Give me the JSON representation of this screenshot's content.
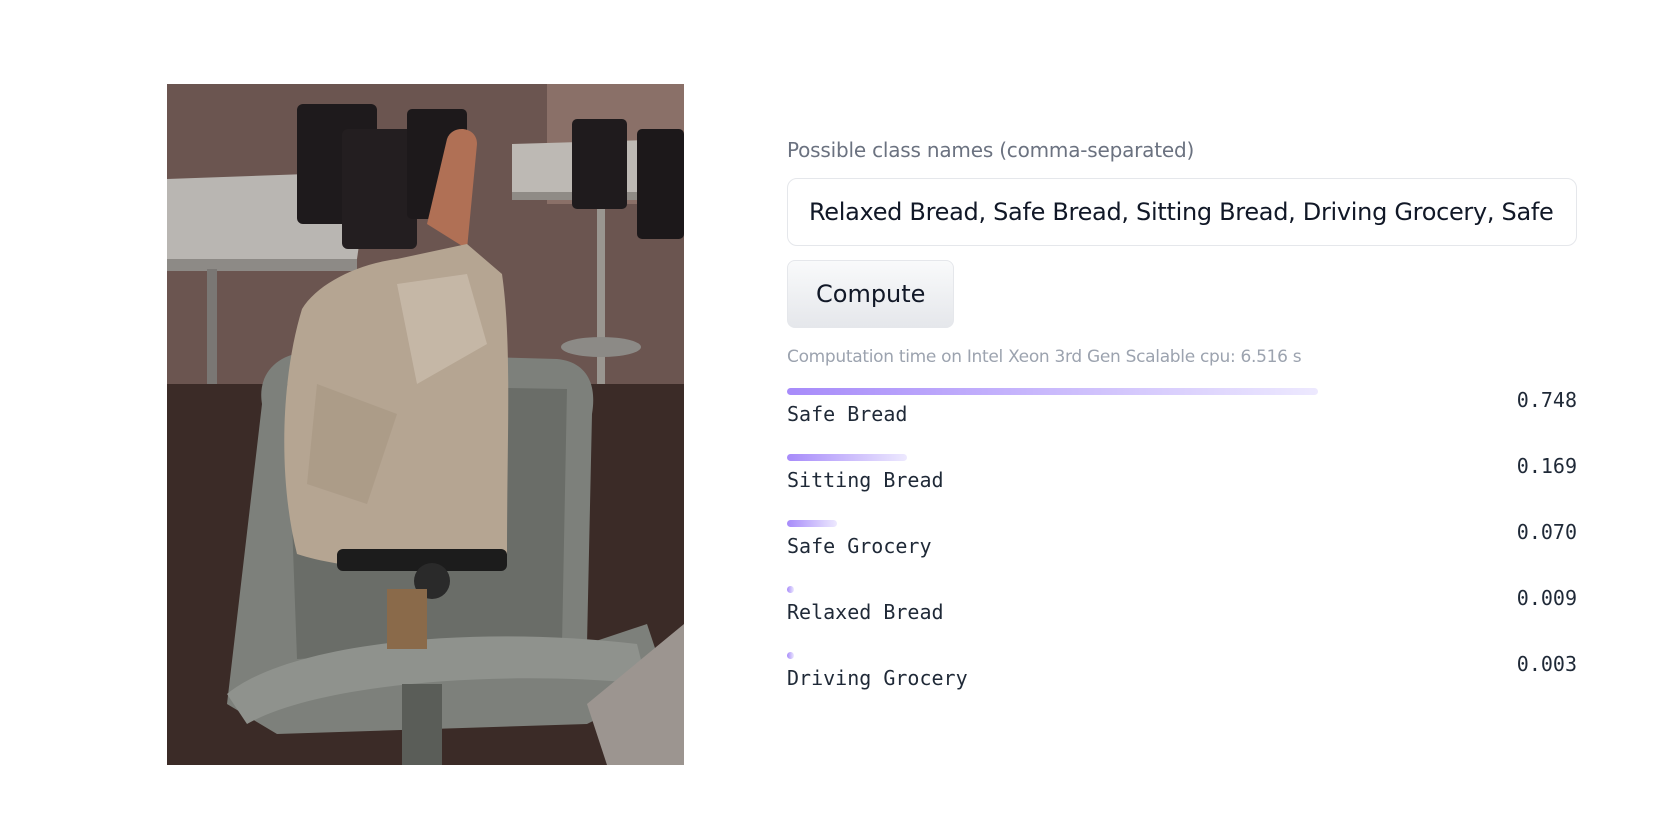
{
  "image": {
    "description_icon": "photo-image"
  },
  "form": {
    "label": "Possible class names (comma-separated)",
    "input_value": "Relaxed Bread, Safe Bread, Sitting Bread, Driving Grocery, Safe",
    "compute_label": "Compute"
  },
  "timing": "Computation time on Intel Xeon 3rd Gen Scalable cpu: 6.516 s",
  "results": [
    {
      "label": "Safe Bread",
      "score": "0.748",
      "value": 0.748
    },
    {
      "label": "Sitting Bread",
      "score": "0.169",
      "value": 0.169
    },
    {
      "label": "Safe Grocery",
      "score": "0.070",
      "value": 0.07
    },
    {
      "label": "Relaxed Bread",
      "score": "0.009",
      "value": 0.009
    },
    {
      "label": "Driving Grocery",
      "score": "0.003",
      "value": 0.003
    }
  ],
  "colors": {
    "bar_start": "#a78bfa",
    "bar_end": "#ede9fe"
  }
}
